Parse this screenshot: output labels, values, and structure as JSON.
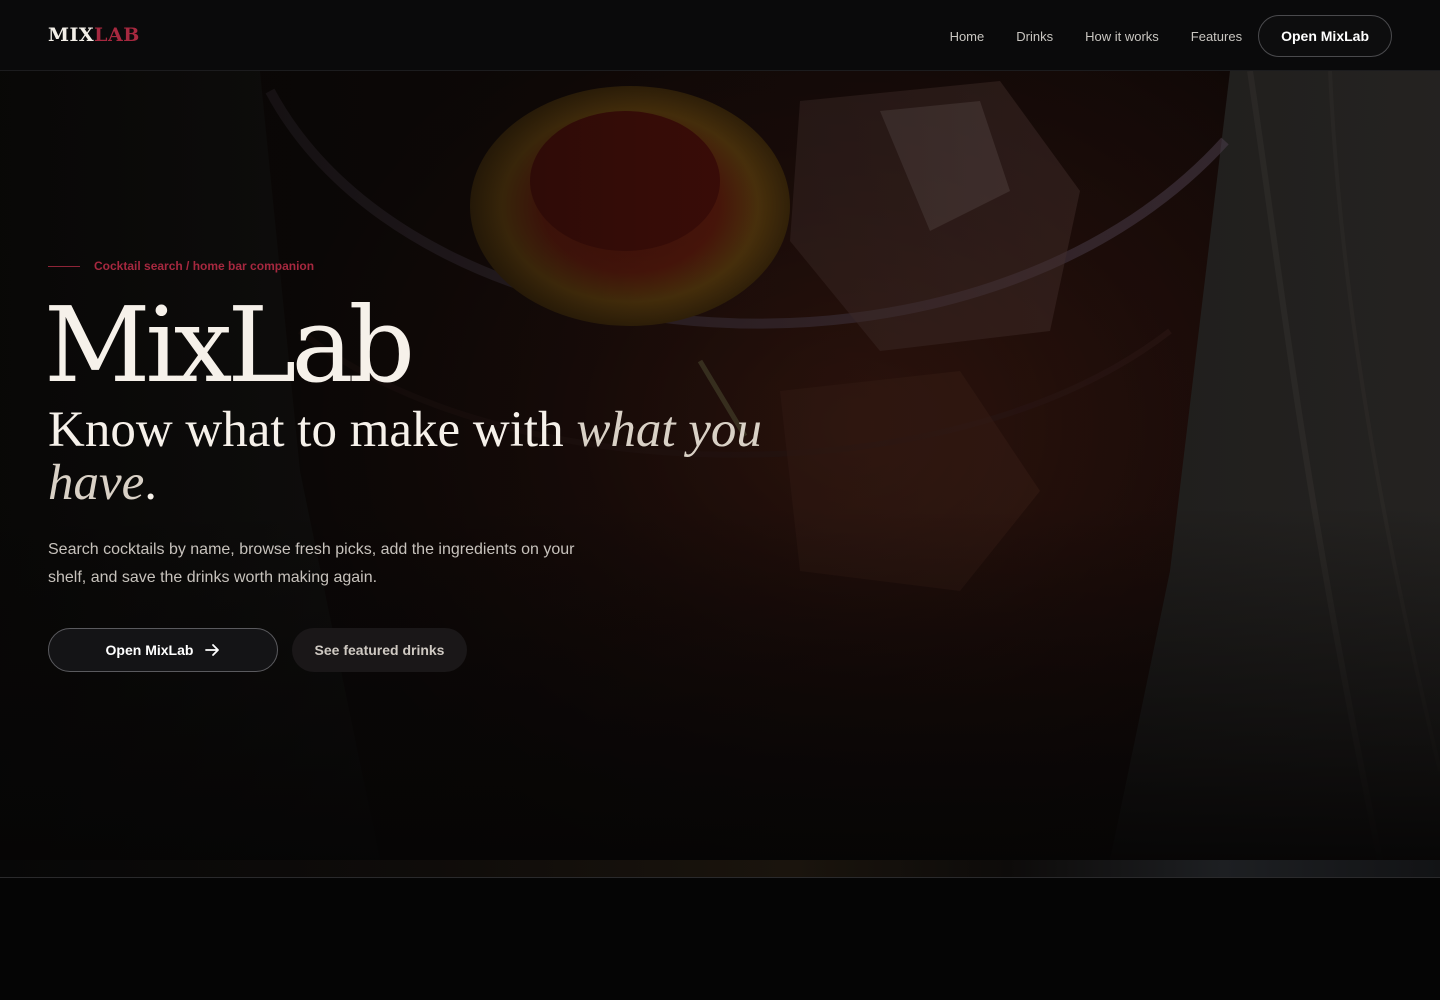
{
  "header": {
    "logo_part1": "MIX",
    "logo_part2": "LAB",
    "nav": [
      {
        "label": "Home"
      },
      {
        "label": "Drinks"
      },
      {
        "label": "How it works"
      },
      {
        "label": "Features"
      }
    ],
    "cta_label": "Open MixLab"
  },
  "hero": {
    "eyebrow": "Cocktail search / home bar companion",
    "title": "MixLab",
    "subtitle_plain": "Know what to make with ",
    "subtitle_emphasis": "what you have",
    "subtitle_end": ".",
    "description": "Search cocktails by name, browse fresh picks, add the ingredients on your shelf, and save the drinks worth making again.",
    "primary_button": "Open MixLab",
    "secondary_button": "See featured drinks",
    "background_image": "cocktail-glass-photo"
  },
  "colors": {
    "accent": "#a6283f",
    "text": "#f6f1ea",
    "background": "#050505"
  },
  "icons": {
    "primary_button_icon": "arrow-right-icon"
  }
}
